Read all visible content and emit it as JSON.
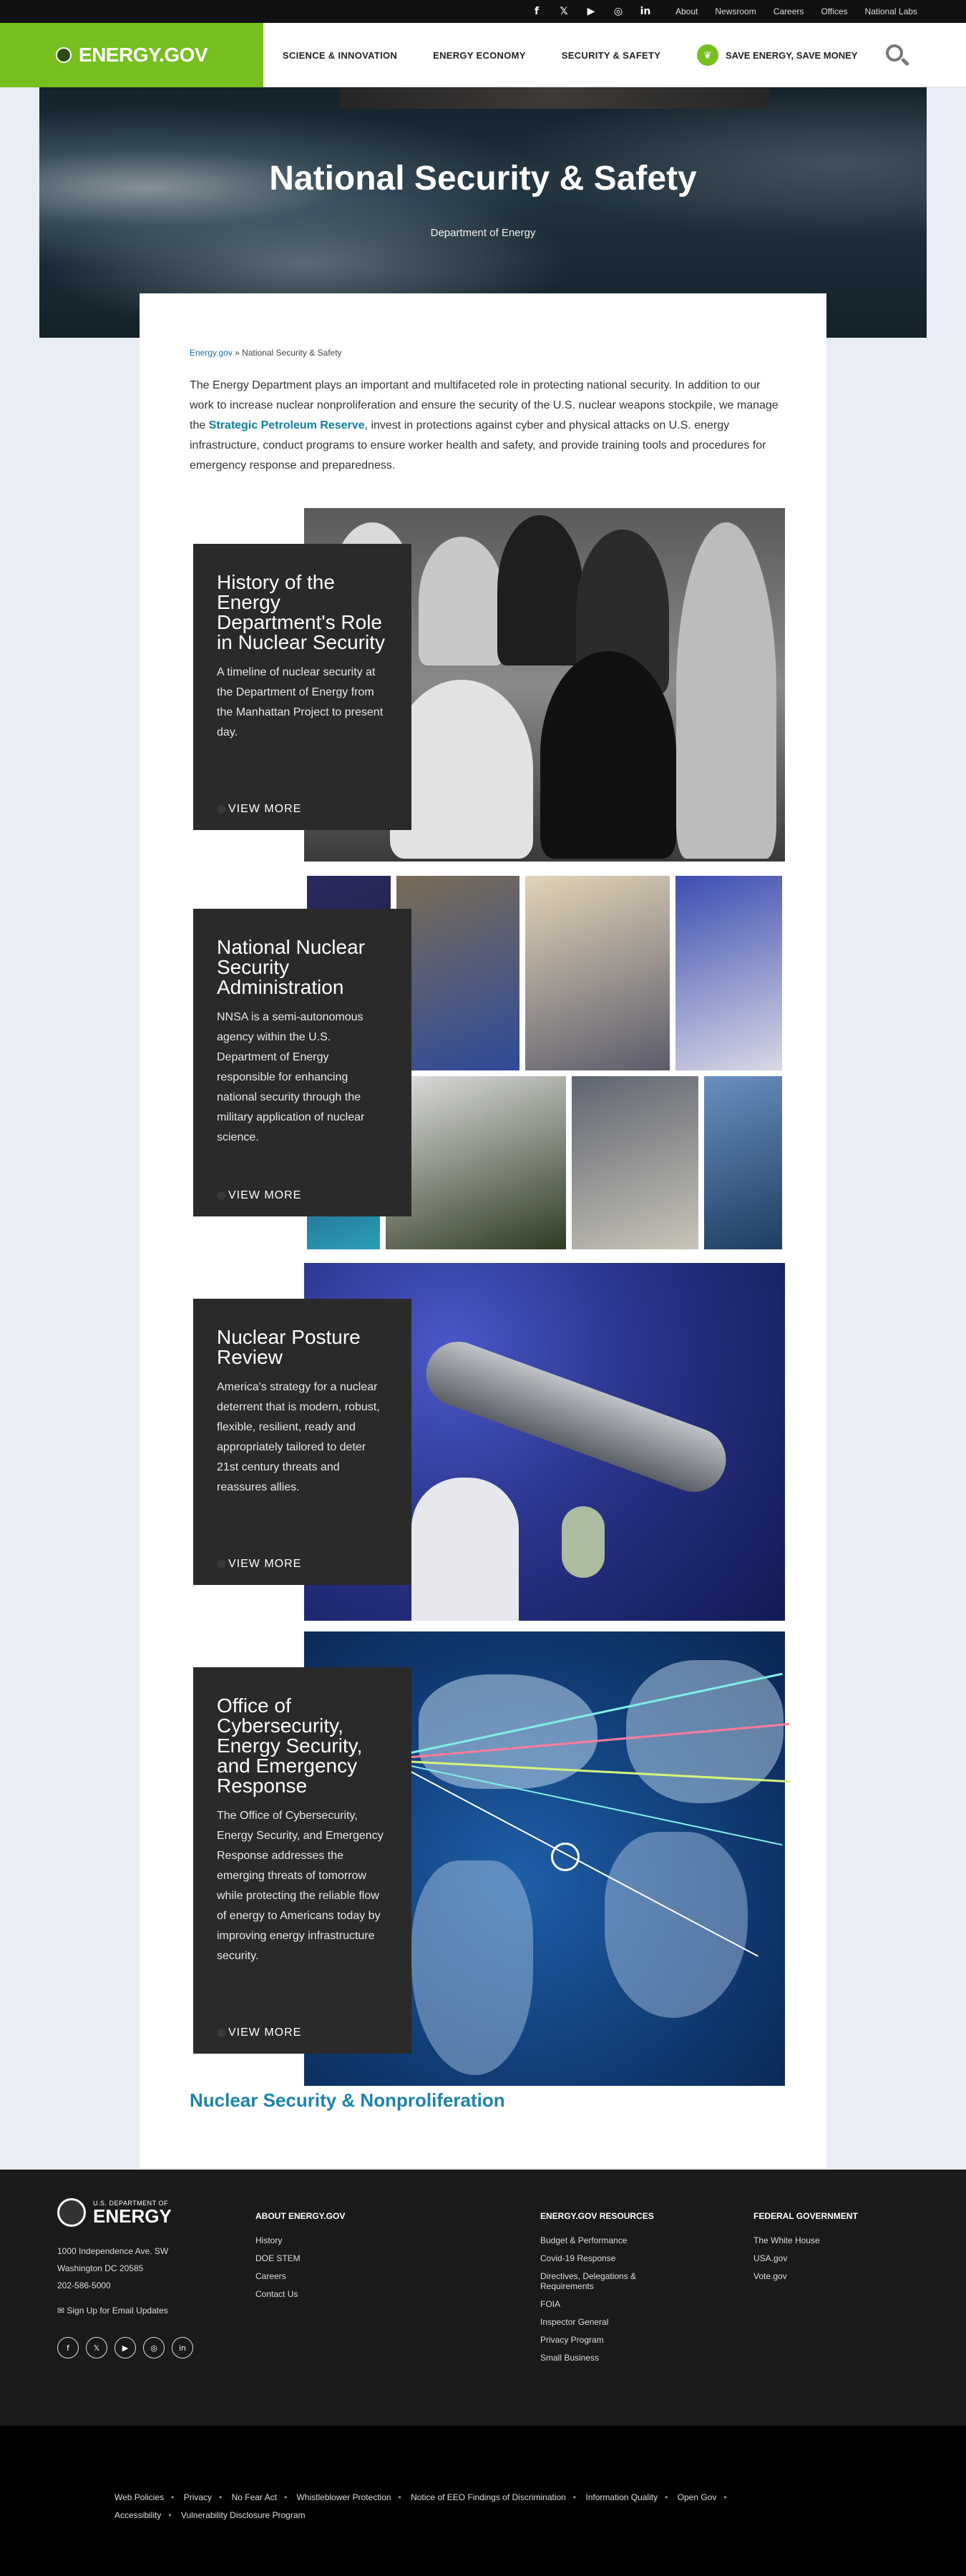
{
  "utility": {
    "social_icons": [
      "facebook-icon",
      "twitter-icon",
      "youtube-icon",
      "instagram-icon",
      "linkedin-icon"
    ],
    "links": [
      "About",
      "Newsroom",
      "Careers",
      "Offices",
      "National Labs"
    ]
  },
  "nav": {
    "logo": "ENERGY.GOV",
    "items": [
      "SCIENCE & INNOVATION",
      "ENERGY ECONOMY",
      "SECURITY & SAFETY"
    ],
    "save_energy": "SAVE ENERGY, SAVE MONEY"
  },
  "hero": {
    "title": "National Security & Safety",
    "subtitle": "Department of Energy"
  },
  "breadcrumb": {
    "home": "Energy.gov",
    "separator": " » ",
    "current": "National Security & Safety"
  },
  "intro": {
    "before": "The Energy Department plays an important and multifaceted role in protecting national security. In addition to our work to increase nuclear nonproliferation and ensure the security of the U.S. nuclear weapons stockpile, we manage the ",
    "link": "Strategic Petroleum Reserve",
    "after": ", invest in protections against cyber and physical attacks on U.S. energy infrastructure, conduct programs to ensure worker health and safety, and provide training tools and procedures for emergency response and preparedness."
  },
  "features": [
    {
      "title": "History of the Energy Department's Role in Nuclear Security",
      "text": "A timeline of nuclear security at the Department of Energy from the Manhattan Project to present day.",
      "more": "VIEW MORE"
    },
    {
      "title": "National Nuclear Security Administration",
      "text": "NNSA is a semi-autonomous agency within the U.S. Department of Energy responsible for enhancing national security through the military application of nuclear science.",
      "more": "VIEW MORE"
    },
    {
      "title": "Nuclear Posture Review",
      "text": "America's strategy for a nuclear deterrent that is modern, robust, flexible, resilient, ready and appropriately tailored to deter 21st century threats and reassures allies.",
      "more": "VIEW MORE"
    },
    {
      "title": "Office of Cybersecurity, Energy Security, and Emergency Response",
      "text": "The Office of Cybersecurity, Energy Security, and Emergency Response addresses the emerging threats of tomorrow while protecting the reliable flow of energy to Americans today by improving energy infrastructure security.",
      "more": "VIEW MORE"
    }
  ],
  "section_heading": "Nuclear Security & Nonproliferation",
  "footer": {
    "logo_small": "U.S. DEPARTMENT OF",
    "logo_big": "ENERGY",
    "address": [
      "1000 Independence Ave. SW",
      "Washington DC 20585",
      "202-586-5000"
    ],
    "email_signup": "Sign Up for Email Updates",
    "columns": [
      {
        "heading": "ABOUT ENERGY.GOV",
        "items": [
          "History",
          "DOE STEM",
          "Careers",
          "Contact Us"
        ]
      },
      {
        "heading": "ENERGY.GOV RESOURCES",
        "items": [
          "Budget & Performance",
          "Covid-19 Response",
          "Directives, Delegations & Requirements",
          "FOIA",
          "Inspector General",
          "Privacy Program",
          "Small Business"
        ]
      },
      {
        "heading": "FEDERAL GOVERNMENT",
        "items": [
          "The White House",
          "USA.gov",
          "Vote.gov"
        ]
      }
    ]
  },
  "legal": [
    "Web Policies",
    "Privacy",
    "No Fear Act",
    "Whistleblower Protection",
    "Notice of EEO Findings of Discrimination",
    "Information Quality",
    "Open Gov",
    "Accessibility",
    "Vulnerability Disclosure Program"
  ],
  "colors": {
    "brand_green": "#77be21",
    "link_blue": "#1e84a8",
    "panel_dark": "#2a2a2a"
  }
}
